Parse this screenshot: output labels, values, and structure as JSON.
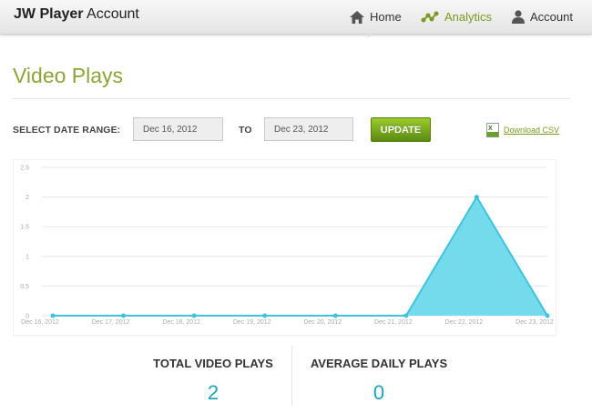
{
  "header": {
    "brand_bold": "JW Player",
    "brand_rest": "Account",
    "nav": [
      {
        "label": "Home",
        "icon": "home-icon"
      },
      {
        "label": "Analytics",
        "icon": "analytics-icon",
        "active": true
      },
      {
        "label": "Account",
        "icon": "user-icon"
      }
    ]
  },
  "page": {
    "title": "Video Plays"
  },
  "controls": {
    "range_label": "SELECT DATE RANGE:",
    "from_value": "Dec 16, 2012",
    "to_label": "TO",
    "to_value": "Dec 23, 2012",
    "update_label": "UPDATE",
    "csv_label": "Download CSV",
    "csv_icon": "excel-icon"
  },
  "chart_data": {
    "type": "area",
    "x": [
      "Dec 16, 2012",
      "Dec 17, 2012",
      "Dec 18, 2012",
      "Dec 19, 2012",
      "Dec 20, 2012",
      "Dec 21, 2012",
      "Dec 22, 2012",
      "Dec 23, 2012"
    ],
    "series": [
      {
        "values": [
          0,
          0,
          0,
          0,
          0,
          0,
          2,
          0
        ]
      }
    ],
    "yticks": [
      "0",
      "0.5",
      "1",
      "1.5",
      "2",
      "2.5"
    ],
    "ylim": [
      0,
      2.5
    ],
    "grid": true,
    "colors": {
      "fill": "#6dd9ec",
      "line": "#3fc3da",
      "grid": "#e6e6e6",
      "tick": "#aaaaaa"
    }
  },
  "stats": {
    "total_label": "TOTAL VIDEO PLAYS",
    "total_value": "2",
    "avg_label": "AVERAGE DAILY PLAYS",
    "avg_value": "0"
  },
  "colors": {
    "accent": "#8aa538",
    "stat_value": "#1ba3b5",
    "button": "#7ab220"
  }
}
